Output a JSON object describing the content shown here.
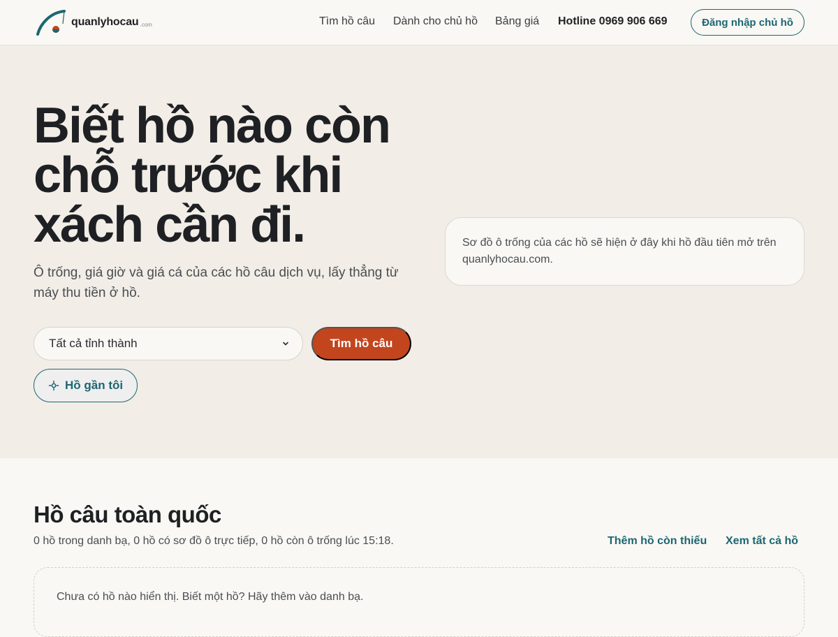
{
  "header": {
    "logo_text": "quanlyhocau",
    "logo_suffix": ".com",
    "nav": {
      "find": "Tìm hồ câu",
      "owner": "Dành cho chủ hồ",
      "pricing": "Bảng giá",
      "hotline": "Hotline 0969 906 669"
    },
    "login_label": "Đăng nhập chủ hồ"
  },
  "hero": {
    "title": "Biết hồ nào còn chỗ trước khi xách cần đi.",
    "subtitle": "Ô trống, giá giờ và giá cá của các hồ câu dịch vụ, lấy thẳng từ máy thu tiền ở hồ.",
    "province_select": "Tất cả tỉnh thành",
    "find_button": "Tìm hồ câu",
    "near_button": "Hồ gần tôi",
    "map_placeholder": "Sơ đồ ô trống của các hồ sẽ hiện ở đây khi hồ đầu tiên mở trên quanlyhocau.com."
  },
  "section": {
    "title": "Hồ câu toàn quốc",
    "summary": "0 hồ trong danh bạ, 0 hồ có sơ đồ ô trực tiếp, 0 hồ còn ô trống lúc 15:18.",
    "add_link": "Thêm hồ còn thiếu",
    "all_link": "Xem tất cả hồ",
    "empty_text": "Chưa có hồ nào hiển thị. Biết một hồ? Hãy thêm vào danh bạ."
  },
  "colors": {
    "accent_teal": "#1d6672",
    "accent_orange": "#c2451e",
    "hero_bg": "#f2ede6",
    "page_bg": "#f9f8f4"
  },
  "icons": {
    "logo": "fishing-rod-logo-icon",
    "chevron": "chevron-down-icon",
    "location": "locate-icon"
  }
}
